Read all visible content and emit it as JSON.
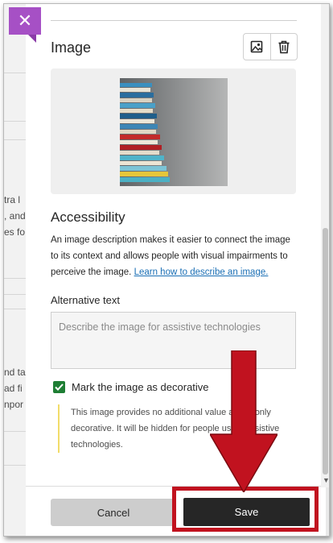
{
  "background_page": {
    "fragments": [
      "tra l",
      ", and",
      "es fo",
      "nd ta",
      "ad fi",
      "npor"
    ]
  },
  "close_label": "✕",
  "image_section": {
    "title": "Image",
    "icons": [
      "image-replace-icon",
      "trash-icon"
    ]
  },
  "accessibility": {
    "title": "Accessibility",
    "description": "An image description makes it easier to connect the image to its context and allows people with visual impairments to perceive the image.",
    "link_text": "Learn how to describe an image."
  },
  "alt_text": {
    "label": "Alternative text",
    "placeholder": "Describe the image for assistive technologies",
    "value": ""
  },
  "decorative": {
    "checked": true,
    "label": "Mark the image as decorative",
    "note": "This image provides no additional value and is only decorative. It will be hidden for people using assistive technologies."
  },
  "footer": {
    "cancel_label": "Cancel",
    "save_label": "Save"
  },
  "colors": {
    "accent_purple": "#a650c5",
    "save_dark": "#262626",
    "annotation_red": "#c1121f",
    "check_green": "#1e7e34",
    "link_blue": "#1a6fb5"
  }
}
